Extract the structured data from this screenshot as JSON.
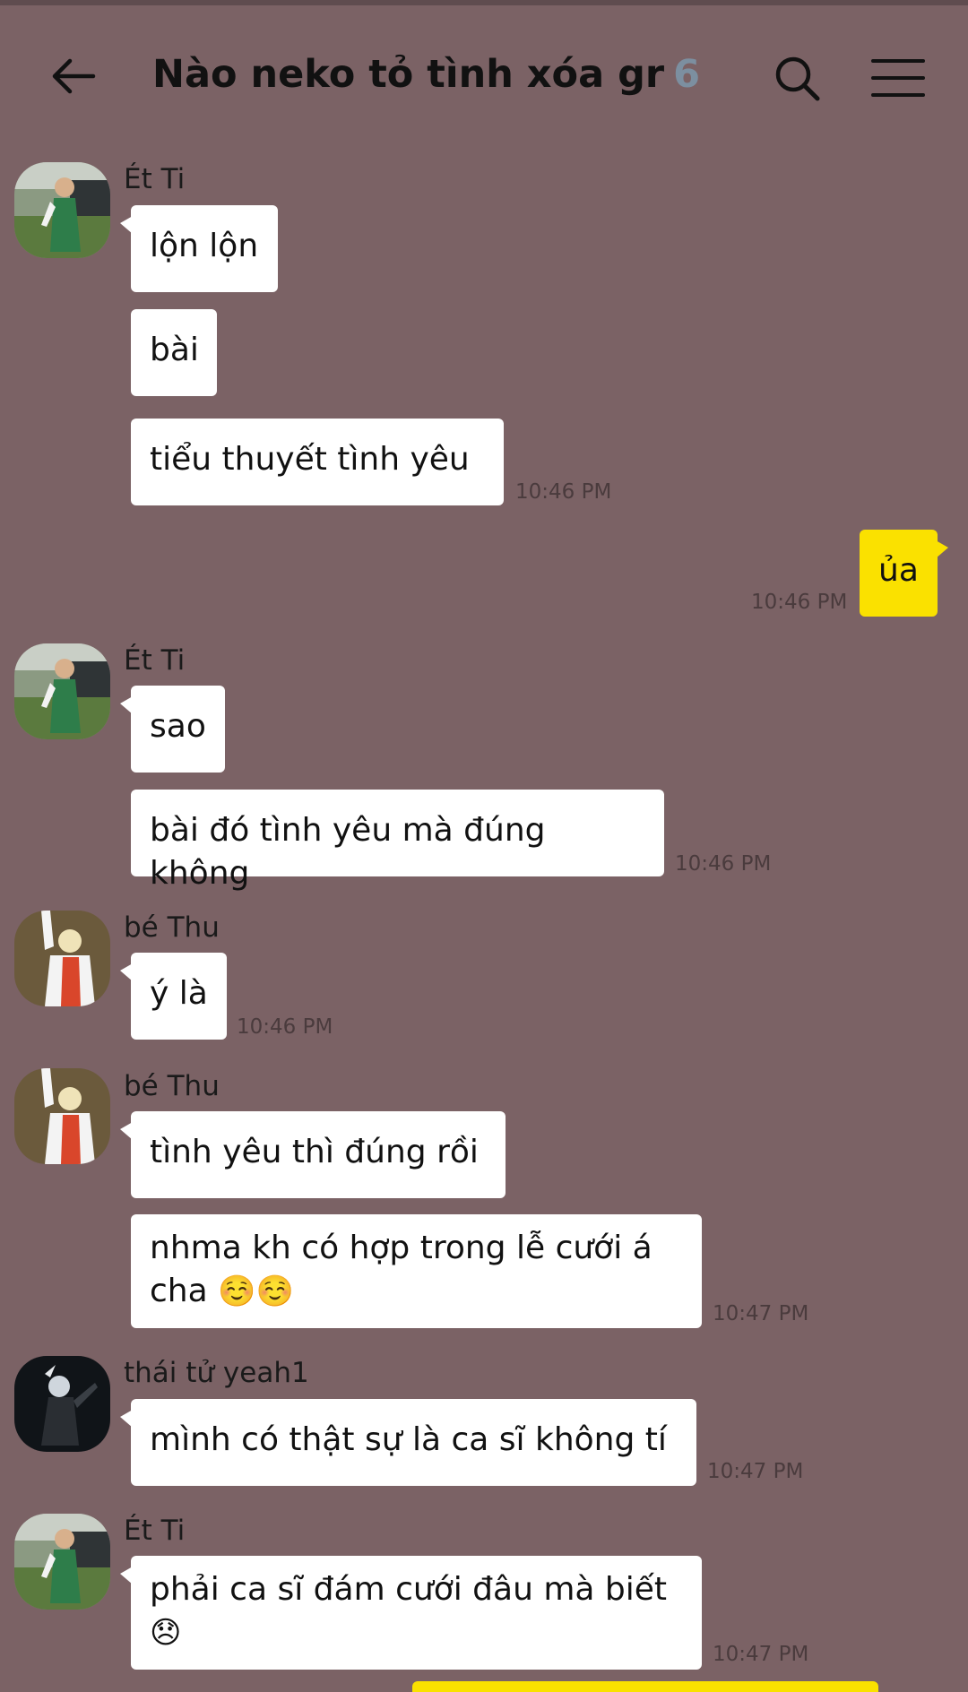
{
  "header": {
    "title": "Nào neko tỏ tình xóa gr",
    "member_count": "6"
  },
  "senders": {
    "et_ti": "Ét Ti",
    "be_thu": "bé Thu",
    "thai_tu": "thái tử yeah1"
  },
  "messages": {
    "m1": "lộn lộn",
    "m2": "bài",
    "m3": "tiểu thuyết tình yêu",
    "m4": "ủa",
    "m5": "sao",
    "m6": "bài đó tình yêu mà đúng không",
    "m7": "ý là",
    "m8": "tình yêu thì đúng rồi",
    "m9_line1": "nhma kh có hợp trong lễ cưới á",
    "m9_line2": "cha",
    "m9_emoji": "☺️☺️",
    "m10": "mình có thật sự là ca sĩ không tí",
    "m11_line1": "phải ca sĩ đám cưới đâu mà biết",
    "m11_emoji": "😞"
  },
  "times": {
    "t1": "10:46 PM",
    "t2": "10:46 PM",
    "t3": "10:46 PM",
    "t4": "10:46 PM",
    "t5": "10:47 PM",
    "t6": "10:47 PM",
    "t7": "10:47 PM"
  },
  "colors": {
    "background": "#7B6265",
    "incoming_bubble": "#FFFFFF",
    "outgoing_bubble": "#FAE100",
    "member_count": "#7C8FA0"
  },
  "icons": [
    "back-arrow-icon",
    "search-icon",
    "menu-icon"
  ]
}
